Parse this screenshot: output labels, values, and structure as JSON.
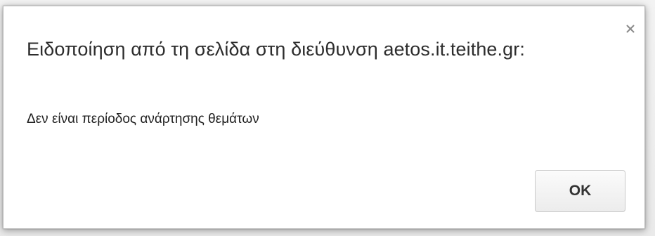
{
  "dialog": {
    "title": "Ειδοποίηση από τη σελίδα στη διεύθυνση aetos.it.teithe.gr:",
    "message": "Δεν είναι περίοδος ανάρτησης θεμάτων",
    "ok_label": "OK",
    "close_icon": "close-icon"
  }
}
